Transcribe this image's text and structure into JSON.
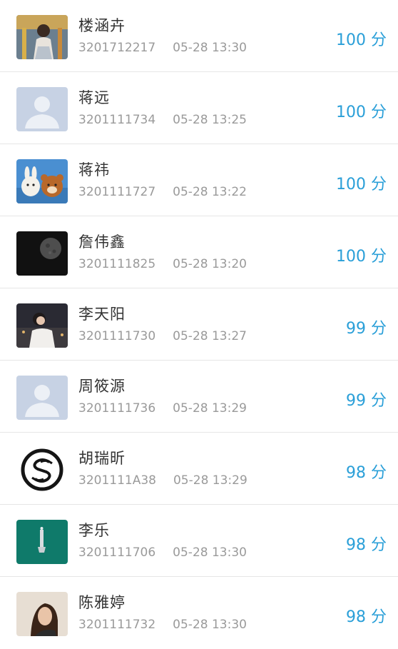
{
  "colors": {
    "score": "#2a9fd8",
    "name": "#333333",
    "meta": "#9a9a9a",
    "divider": "#e6e6e6"
  },
  "rows": [
    {
      "name": "楼涵卉",
      "id": "3201712217",
      "time": "05-28 13:30",
      "score": "100 分",
      "avatar_icon": "photo-avatar-person"
    },
    {
      "name": "蒋远",
      "id": "3201111734",
      "time": "05-28 13:25",
      "score": "100 分",
      "avatar_icon": "default-avatar"
    },
    {
      "name": "蒋祎",
      "id": "3201111727",
      "time": "05-28 13:22",
      "score": "100 分",
      "avatar_icon": "cartoon-avatar"
    },
    {
      "name": "詹伟鑫",
      "id": "3201111825",
      "time": "05-28 13:20",
      "score": "100 分",
      "avatar_icon": "moon-avatar"
    },
    {
      "name": "李天阳",
      "id": "3201111730",
      "time": "05-28 13:27",
      "score": "99 分",
      "avatar_icon": "photo-avatar-person"
    },
    {
      "name": "周筱源",
      "id": "3201111736",
      "time": "05-28 13:29",
      "score": "99 分",
      "avatar_icon": "default-avatar"
    },
    {
      "name": "胡瑞昕",
      "id": "3201111A38",
      "time": "05-28 13:29",
      "score": "98 分",
      "avatar_icon": "logo-avatar"
    },
    {
      "name": "李乐",
      "id": "3201111706",
      "time": "05-28 13:30",
      "score": "98 分",
      "avatar_icon": "teal-photo-avatar"
    },
    {
      "name": "陈雅婷",
      "id": "3201111732",
      "time": "05-28 13:30",
      "score": "98 分",
      "avatar_icon": "photo-avatar-person"
    }
  ]
}
